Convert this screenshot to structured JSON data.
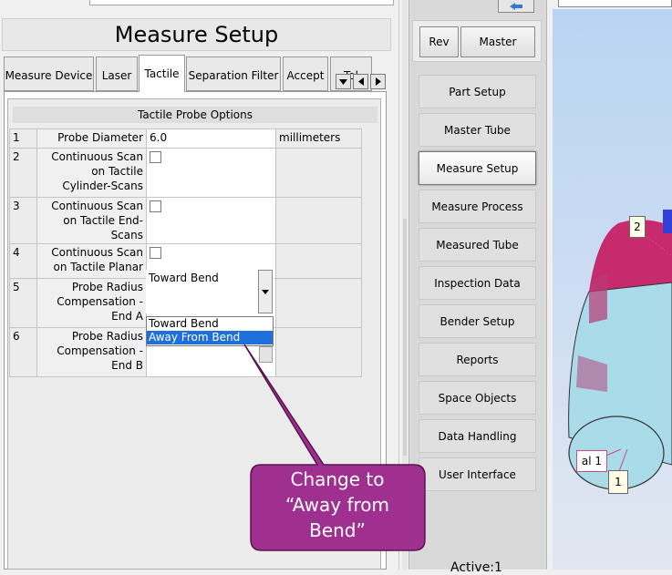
{
  "panel": {
    "title": "Measure Setup",
    "tabs": [
      "Measure Device",
      "Laser",
      "Tactile",
      "Separation Filter",
      "Accept",
      "Tol"
    ],
    "group_title": "Tactile Probe Options",
    "rows": [
      {
        "num": "1",
        "label": "Probe Diameter",
        "value": "6.0",
        "unit": "millimeters"
      },
      {
        "num": "2",
        "label": "Continuous Scan on Tactile Cylinder-Scans"
      },
      {
        "num": "3",
        "label": "Continuous Scan on Tactile End-Scans"
      },
      {
        "num": "4",
        "label": "Continuous Scan on Tactile Planar"
      },
      {
        "num": "5",
        "label": "Probe Radius Compensation - End A",
        "value": "Toward Bend"
      },
      {
        "num": "6",
        "label": "Probe Radius Compensation - End B"
      }
    ],
    "dropdown_options": [
      "Toward Bend",
      "Away From Bend"
    ]
  },
  "toolbar": {
    "rev_label": "Rev",
    "master_label": "Master"
  },
  "nav": {
    "items": [
      "Part Setup",
      "Master Tube",
      "Measure Setup",
      "Measure Process",
      "Measured Tube",
      "Inspection Data",
      "Bender Setup",
      "Reports",
      "Space Objects",
      "Data Handling",
      "User Interface"
    ],
    "active_index": 2,
    "status": "Active:1"
  },
  "view": {
    "marker_top": "2",
    "marker_bottom": "1",
    "label_tag": "al 1"
  },
  "callout": {
    "line1": "Change to",
    "line2": "“Away from",
    "line3": "Bend”"
  },
  "colors": {
    "callout_fill": "#a0308f",
    "selection": "#1e6fd9",
    "tube": "#a9dbe9",
    "tube_end": "#d02b72"
  }
}
